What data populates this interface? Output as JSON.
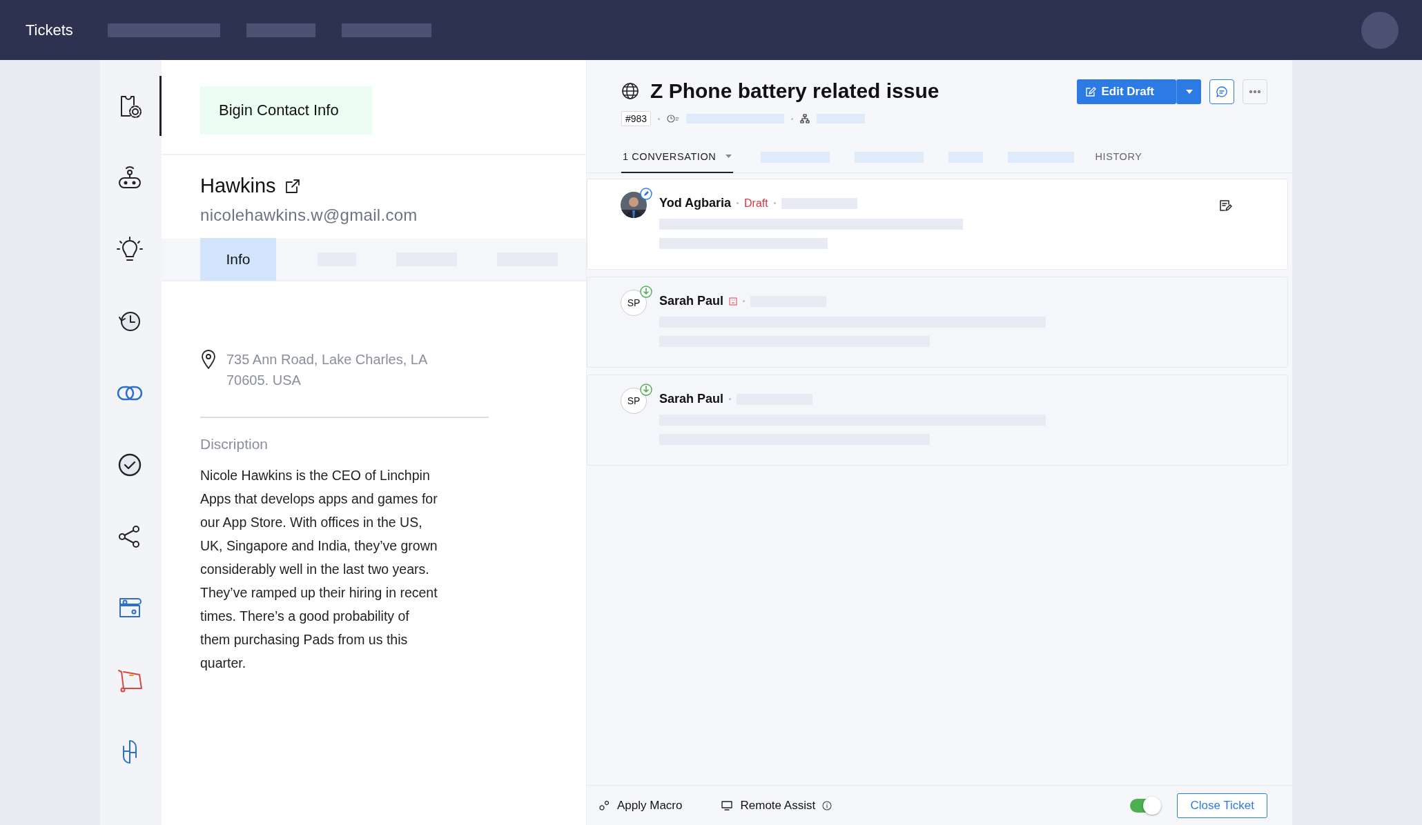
{
  "top_bar": {
    "title": "Tickets"
  },
  "sidebar": {
    "items": [
      {
        "kind": "ticket-settings",
        "selected": true
      },
      {
        "kind": "bot",
        "selected": false
      },
      {
        "kind": "idea",
        "selected": false
      },
      {
        "kind": "history",
        "selected": false
      },
      {
        "kind": "link",
        "selected": false
      },
      {
        "kind": "check",
        "selected": false
      },
      {
        "kind": "share",
        "selected": false
      },
      {
        "kind": "layout",
        "selected": false
      },
      {
        "kind": "cart",
        "selected": false
      },
      {
        "kind": "logo",
        "selected": false
      }
    ]
  },
  "contact": {
    "badge": "Bigin Contact Info",
    "name": "Hawkins",
    "email": "nicolehawkins.w@gmail.com",
    "tabs": [
      {
        "label": "Info",
        "selected": true
      }
    ],
    "address": "735 Ann Road, Lake Charles, LA 70605. USA",
    "description_label": "Discription",
    "description": "Nicole Hawkins is the CEO of Linchpin Apps that develops apps and games for our App Store. With offices in the US, UK, Singapore and India, they’ve grown considerably well in the last two years. They’ve ramped up their hiring in recent times. There’s a good probability of them purchasing Pads from us this quarter."
  },
  "ticket": {
    "title": "Z Phone battery related issue",
    "number": "#983",
    "edit_button": "Edit Draft",
    "tabs": [
      {
        "label": "1 CONVERSATION",
        "selected": true
      },
      {
        "label": "HISTORY",
        "selected": false
      }
    ],
    "conversations": [
      {
        "kind": "draft",
        "author": "Yod Agbaria",
        "status": "Draft",
        "flagged": false
      },
      {
        "kind": "reply",
        "author": "Sarah Paul",
        "initials": "SP",
        "flagged": true
      },
      {
        "kind": "reply",
        "author": "Sarah Paul",
        "initials": "SP",
        "flagged": false
      }
    ]
  },
  "footer": {
    "apply_macro": "Apply Macro",
    "remote_assist": "Remote Assist",
    "toggle_on": true,
    "close_button": "Close Ticket"
  }
}
